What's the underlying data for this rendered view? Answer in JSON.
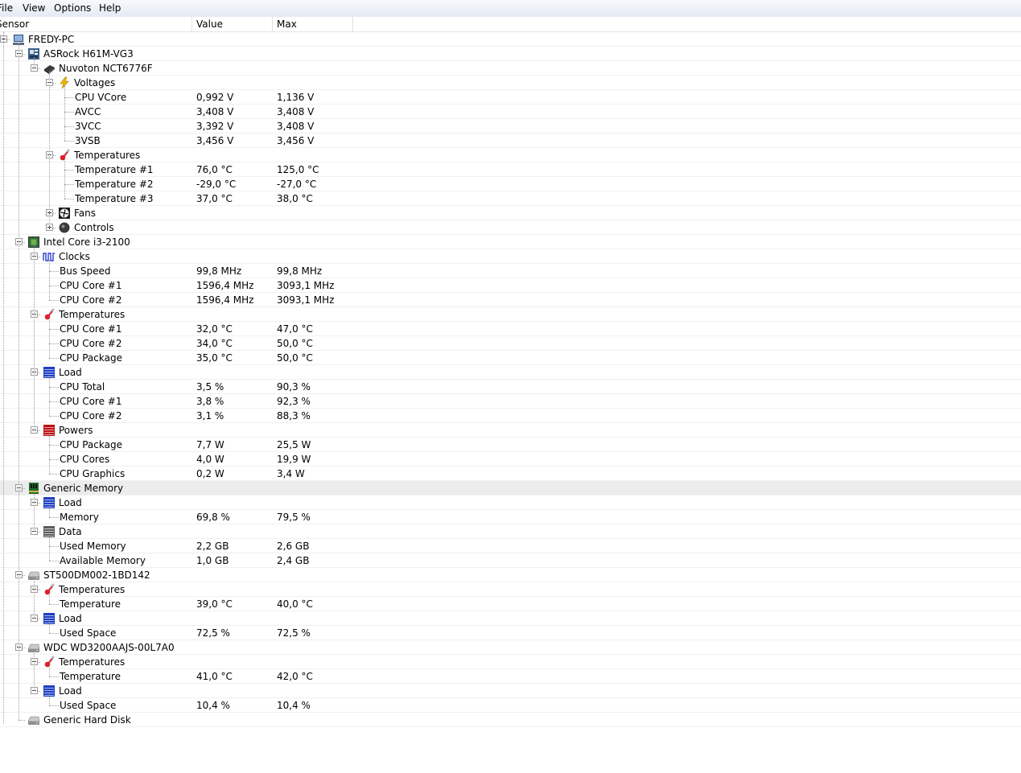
{
  "menu": [
    "File",
    "View",
    "Options",
    "Help"
  ],
  "columns": {
    "sensor": "Sensor",
    "value": "Value",
    "max": "Max"
  },
  "tree": [
    {
      "level": 0,
      "label": "FREDY-PC",
      "icon": "computer-icon",
      "toggle": "minus"
    },
    {
      "level": 1,
      "label": "ASRock H61M-VG3",
      "icon": "motherboard-icon",
      "toggle": "minus"
    },
    {
      "level": 2,
      "label": "Nuvoton NCT6776F",
      "icon": "chip-icon",
      "toggle": "minus"
    },
    {
      "level": 3,
      "label": "Voltages",
      "icon": "lightning-icon",
      "toggle": "minus"
    },
    {
      "level": 4,
      "label": "CPU VCore",
      "value": "0,992 V",
      "max": "1,136 V"
    },
    {
      "level": 4,
      "label": "AVCC",
      "value": "3,408 V",
      "max": "3,408 V"
    },
    {
      "level": 4,
      "label": "3VCC",
      "value": "3,392 V",
      "max": "3,408 V"
    },
    {
      "level": 4,
      "label": "3VSB",
      "value": "3,456 V",
      "max": "3,456 V"
    },
    {
      "level": 3,
      "label": "Temperatures",
      "icon": "thermometer-icon",
      "toggle": "minus"
    },
    {
      "level": 4,
      "label": "Temperature #1",
      "value": "76,0 °C",
      "max": "125,0 °C"
    },
    {
      "level": 4,
      "label": "Temperature #2",
      "value": "-29,0 °C",
      "max": "-27,0 °C"
    },
    {
      "level": 4,
      "label": "Temperature #3",
      "value": "37,0 °C",
      "max": "38,0 °C"
    },
    {
      "level": 3,
      "label": "Fans",
      "icon": "fan-icon",
      "toggle": "plus"
    },
    {
      "level": 3,
      "label": "Controls",
      "icon": "controls-icon",
      "toggle": "plus"
    },
    {
      "level": 1,
      "label": "Intel Core i3-2100",
      "icon": "cpu-icon",
      "toggle": "minus"
    },
    {
      "level": 2,
      "label": "Clocks",
      "icon": "clock-wave-icon",
      "toggle": "minus"
    },
    {
      "level": 3,
      "label": "Bus Speed",
      "value": "99,8 MHz",
      "max": "99,8 MHz"
    },
    {
      "level": 3,
      "label": "CPU Core #1",
      "value": "1596,4 MHz",
      "max": "3093,1 MHz"
    },
    {
      "level": 3,
      "label": "CPU Core #2",
      "value": "1596,4 MHz",
      "max": "3093,1 MHz"
    },
    {
      "level": 2,
      "label": "Temperatures",
      "icon": "thermometer-icon",
      "toggle": "minus"
    },
    {
      "level": 3,
      "label": "CPU Core #1",
      "value": "32,0 °C",
      "max": "47,0 °C"
    },
    {
      "level": 3,
      "label": "CPU Core #2",
      "value": "34,0 °C",
      "max": "50,0 °C"
    },
    {
      "level": 3,
      "label": "CPU Package",
      "value": "35,0 °C",
      "max": "50,0 °C"
    },
    {
      "level": 2,
      "label": "Load",
      "icon": "load-icon",
      "toggle": "minus"
    },
    {
      "level": 3,
      "label": "CPU Total",
      "value": "3,5 %",
      "max": "90,3 %"
    },
    {
      "level": 3,
      "label": "CPU Core #1",
      "value": "3,8 %",
      "max": "92,3 %"
    },
    {
      "level": 3,
      "label": "CPU Core #2",
      "value": "3,1 %",
      "max": "88,3 %"
    },
    {
      "level": 2,
      "label": "Powers",
      "icon": "power-icon",
      "toggle": "minus"
    },
    {
      "level": 3,
      "label": "CPU Package",
      "value": "7,7 W",
      "max": "25,5 W"
    },
    {
      "level": 3,
      "label": "CPU Cores",
      "value": "4,0 W",
      "max": "19,9 W"
    },
    {
      "level": 3,
      "label": "CPU Graphics",
      "value": "0,2 W",
      "max": "3,4 W"
    },
    {
      "level": 1,
      "label": "Generic Memory",
      "icon": "ram-icon",
      "toggle": "minus",
      "highlight": true
    },
    {
      "level": 2,
      "label": "Load",
      "icon": "load-icon",
      "toggle": "minus"
    },
    {
      "level": 3,
      "label": "Memory",
      "value": "69,8 %",
      "max": "79,5 %"
    },
    {
      "level": 2,
      "label": "Data",
      "icon": "data-icon",
      "toggle": "minus"
    },
    {
      "level": 3,
      "label": "Used Memory",
      "value": "2,2 GB",
      "max": "2,6 GB"
    },
    {
      "level": 3,
      "label": "Available Memory",
      "value": "1,0 GB",
      "max": "2,4 GB"
    },
    {
      "level": 1,
      "label": "ST500DM002-1BD142",
      "icon": "hdd-icon",
      "toggle": "minus"
    },
    {
      "level": 2,
      "label": "Temperatures",
      "icon": "thermometer-icon",
      "toggle": "minus"
    },
    {
      "level": 3,
      "label": "Temperature",
      "value": "39,0 °C",
      "max": "40,0 °C"
    },
    {
      "level": 2,
      "label": "Load",
      "icon": "load-icon",
      "toggle": "minus"
    },
    {
      "level": 3,
      "label": "Used Space",
      "value": "72,5 %",
      "max": "72,5 %"
    },
    {
      "level": 1,
      "label": "WDC WD3200AAJS-00L7A0",
      "icon": "hdd-icon",
      "toggle": "minus"
    },
    {
      "level": 2,
      "label": "Temperatures",
      "icon": "thermometer-icon",
      "toggle": "minus"
    },
    {
      "level": 3,
      "label": "Temperature",
      "value": "41,0 °C",
      "max": "42,0 °C"
    },
    {
      "level": 2,
      "label": "Load",
      "icon": "load-icon",
      "toggle": "minus"
    },
    {
      "level": 3,
      "label": "Used Space",
      "value": "10,4 %",
      "max": "10,4 %"
    },
    {
      "level": 1,
      "label": "Generic Hard Disk",
      "icon": "hdd-icon"
    }
  ]
}
